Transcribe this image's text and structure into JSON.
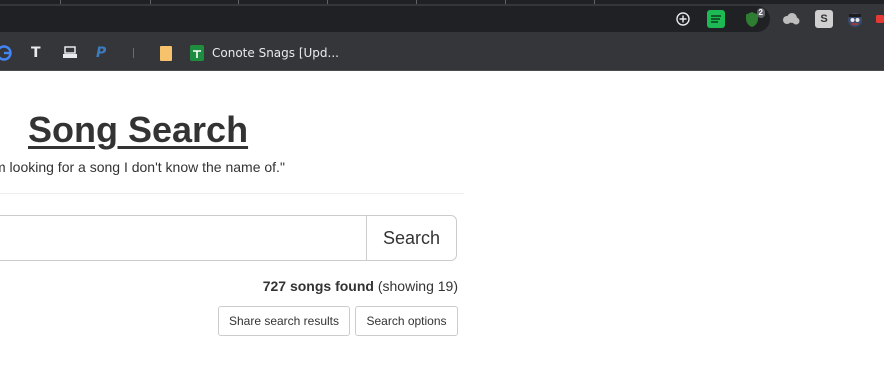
{
  "browser": {
    "colors": {
      "frame": "#202124",
      "toolbar": "#35363a",
      "text": "#e8eaed"
    },
    "extensions": [
      {
        "name": "add-icon",
        "glyph": "⊕",
        "color": "#e8eaed"
      },
      {
        "name": "spotify-icon",
        "glyph": "≡",
        "color": "#1db954"
      },
      {
        "name": "shield-extension-icon",
        "glyph": "⬟",
        "color": "#2e7d32",
        "badge": "2"
      },
      {
        "name": "cloud-extension-icon",
        "glyph": "☁",
        "color": "#bdbdbd"
      },
      {
        "name": "s-extension-icon",
        "glyph": "S",
        "color": "#9e9e9e"
      },
      {
        "name": "spy-extension-icon",
        "glyph": "●",
        "color": "#8e3b3b"
      },
      {
        "name": "red-extension-icon",
        "glyph": "A",
        "color": "#e53935"
      }
    ],
    "bookmarks": [
      {
        "name": "google-icon",
        "glyph": "G",
        "color": "#4285f4",
        "label": ""
      },
      {
        "name": "t-bookmark-icon",
        "glyph": "T",
        "color": "#e8eaed",
        "label": ""
      },
      {
        "name": "printer-bookmark-icon",
        "glyph": "▬",
        "color": "#e8eaed",
        "label": ""
      },
      {
        "name": "paypal-bookmark-icon",
        "glyph": "P",
        "color": "#3b7bbf",
        "label": ""
      },
      {
        "name": "folder-bookmark-icon",
        "glyph": "▮",
        "color": "#f6c26b",
        "label": ""
      },
      {
        "name": "sheets-bookmark-icon",
        "glyph": "╋",
        "color": "#1e8e3e",
        "label": "Conote Snags [Upd..."
      }
    ]
  },
  "page": {
    "title": "Song Search",
    "quote": "m looking for a song I don't know the name of.\"",
    "search": {
      "value": "",
      "placeholder": "",
      "button": "Search"
    },
    "results": {
      "count_text": "727 songs found",
      "showing_text": "(showing 19)"
    },
    "buttons": {
      "share": "Share search results",
      "options": "Search options"
    }
  }
}
